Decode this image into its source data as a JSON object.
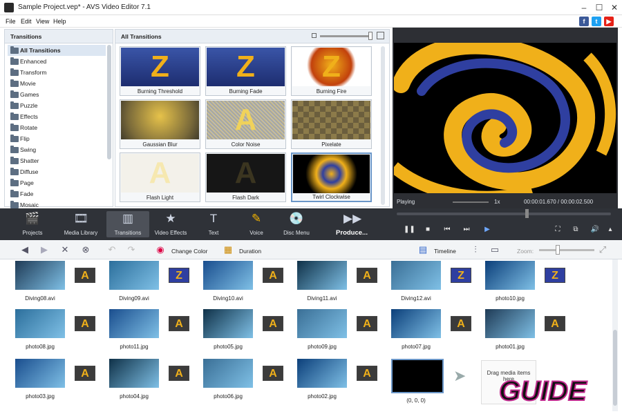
{
  "window": {
    "title": "Sample Project.vep* - AVS Video Editor 7.1",
    "controls": [
      "–",
      "☐",
      "✕"
    ]
  },
  "menu": [
    "File",
    "Edit",
    "View",
    "Help"
  ],
  "social": [
    {
      "label": "f",
      "color": "#3b5998"
    },
    {
      "label": "t",
      "color": "#1da1f2"
    },
    {
      "label": "▶",
      "color": "#e62117"
    }
  ],
  "transitions_panel": {
    "header": "Transitions",
    "items": [
      "All Transitions",
      "Enhanced",
      "Transform",
      "Movie",
      "Games",
      "Puzzle",
      "Effects",
      "Rotate",
      "Flip",
      "Swing",
      "Shatter",
      "Diffuse",
      "Page",
      "Fade",
      "Mosaic"
    ],
    "selected": "All Transitions"
  },
  "grid": {
    "header": "All Transitions",
    "tiles": [
      {
        "name": "Burning Threshold",
        "style": "z"
      },
      {
        "name": "Burning Fade",
        "style": "z"
      },
      {
        "name": "Burning Fire",
        "style": "zfire"
      },
      {
        "name": "Gaussian Blur",
        "style": "blur"
      },
      {
        "name": "Color Noise",
        "style": "noise"
      },
      {
        "name": "Pixelate",
        "style": "pixel"
      },
      {
        "name": "Flash Light",
        "style": "flash"
      },
      {
        "name": "Flash Dark",
        "style": "dark"
      },
      {
        "name": "Twirl Clockwise",
        "style": "twirl"
      }
    ],
    "glyph_z": "Z",
    "glyph_a": "A"
  },
  "preview": {
    "status": "Playing",
    "speed": "1x",
    "time": "00:00:01.670 / 00:00:02.500"
  },
  "toolbar": {
    "buttons": [
      "Projects",
      "Media Library",
      "Transitions",
      "Video Effects",
      "Text",
      "Voice",
      "Disc Menu",
      "Produce..."
    ],
    "selected": "Transitions"
  },
  "storyboard_toolbar": {
    "change_color": "Change Color",
    "duration": "Duration",
    "timeline": "Timeline",
    "zoom": "Zoom:"
  },
  "media": {
    "rows": [
      [
        "Diving08.avi",
        "Diving09.avi",
        "Diving10.avi",
        "Diving11.avi",
        "Diving12.avi",
        "photo10.jpg"
      ],
      [
        "photo08.jpg",
        "photo11.jpg",
        "photo05.jpg",
        "photo09.jpg",
        "photo07.jpg",
        "photo01.jpg"
      ],
      [
        "photo03.jpg",
        "photo04.jpg",
        "photo06.jpg",
        "photo02.jpg",
        "(0, 0, 0)"
      ]
    ],
    "drag_hint": "Drag media items here"
  },
  "watermark": "GUIDE",
  "colors": {
    "dark_toolbar": "#2f3238",
    "accent": "#f4b400",
    "selection": "#6a96c8"
  }
}
